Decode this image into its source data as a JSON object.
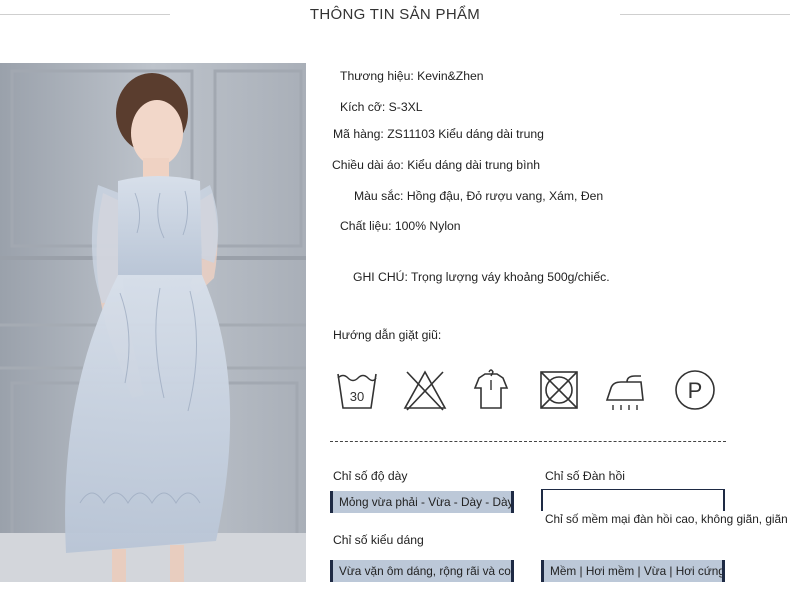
{
  "header": {
    "title": "THÔNG TIN SẢN PHẨM"
  },
  "info": {
    "brand": "Thương hiệu: Kevin&Zhen",
    "size": "Kích cỡ: S-3XL",
    "code": "Mã hàng: ZS11103 Kiểu dáng dài trung",
    "length": "Chiều dài áo: Kiểu dáng dài trung bình",
    "colors": "Màu sắc: Hồng đậu, Đỏ rượu vang, Xám, Đen",
    "material": "Chất liệu: 100% Nylon",
    "note": "GHI CHÚ: Trọng lượng váy khoảng 500g/chiếc."
  },
  "care": {
    "heading": "Hướng dẫn giặt giũ:",
    "wash_temp": "30",
    "professional_clean": "P",
    "icons": [
      "wash-30-icon",
      "no-bleach-icon",
      "hang-dry-icon",
      "no-tumble-dry-icon",
      "iron-icon",
      "professional-clean-icon"
    ]
  },
  "indices": {
    "thickness": {
      "label": "Chỉ số độ dày",
      "scale": "Mỏng vừa phải - Vừa - Dày - Dày hơn"
    },
    "elasticity": {
      "label": "Chỉ số Đàn hồi",
      "scale": "Chỉ số mềm mại đàn hồi cao, không giãn, giãn"
    },
    "fit": {
      "label": "Chỉ số kiểu dáng",
      "scale": "Vừa vặn ôm dáng, rộng rãi và co xu hướng"
    },
    "softness": {
      "scale": "Mềm | Hơi mềm | Vừa | Hơi cứng | Cứng"
    }
  },
  "colors": {
    "bar_fill": "#bcc8d8",
    "bar_edge": "#1e2a44",
    "dress": "#c4cfdd",
    "wall": "#b5bcc6"
  }
}
